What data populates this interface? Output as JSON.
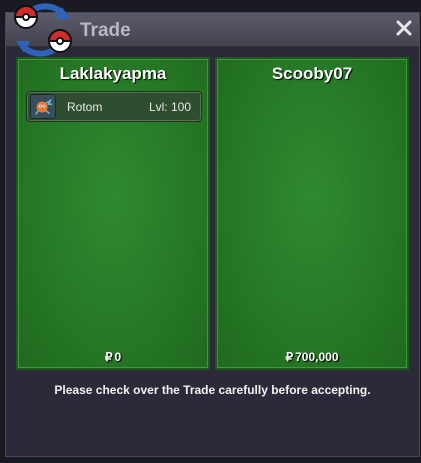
{
  "window": {
    "title": "Trade",
    "close_icon": "close-icon",
    "logo_icon": "pokeball-swap-icon"
  },
  "trade": {
    "left": {
      "player": "Laklakyapma",
      "items": [
        {
          "name": "Rotom",
          "level": "Lvl: 100",
          "icon": "rotom-sprite-icon"
        }
      ],
      "money_symbol": "₽",
      "money": "0"
    },
    "right": {
      "player": "Scooby07",
      "items": [],
      "money_symbol": "₽",
      "money": "700,000"
    }
  },
  "notice": "Please check over the Trade carefully before accepting.",
  "colors": {
    "panel_green": "#267726",
    "window_bg": "#2a2a38",
    "titlebar": "#4d4d5a"
  }
}
